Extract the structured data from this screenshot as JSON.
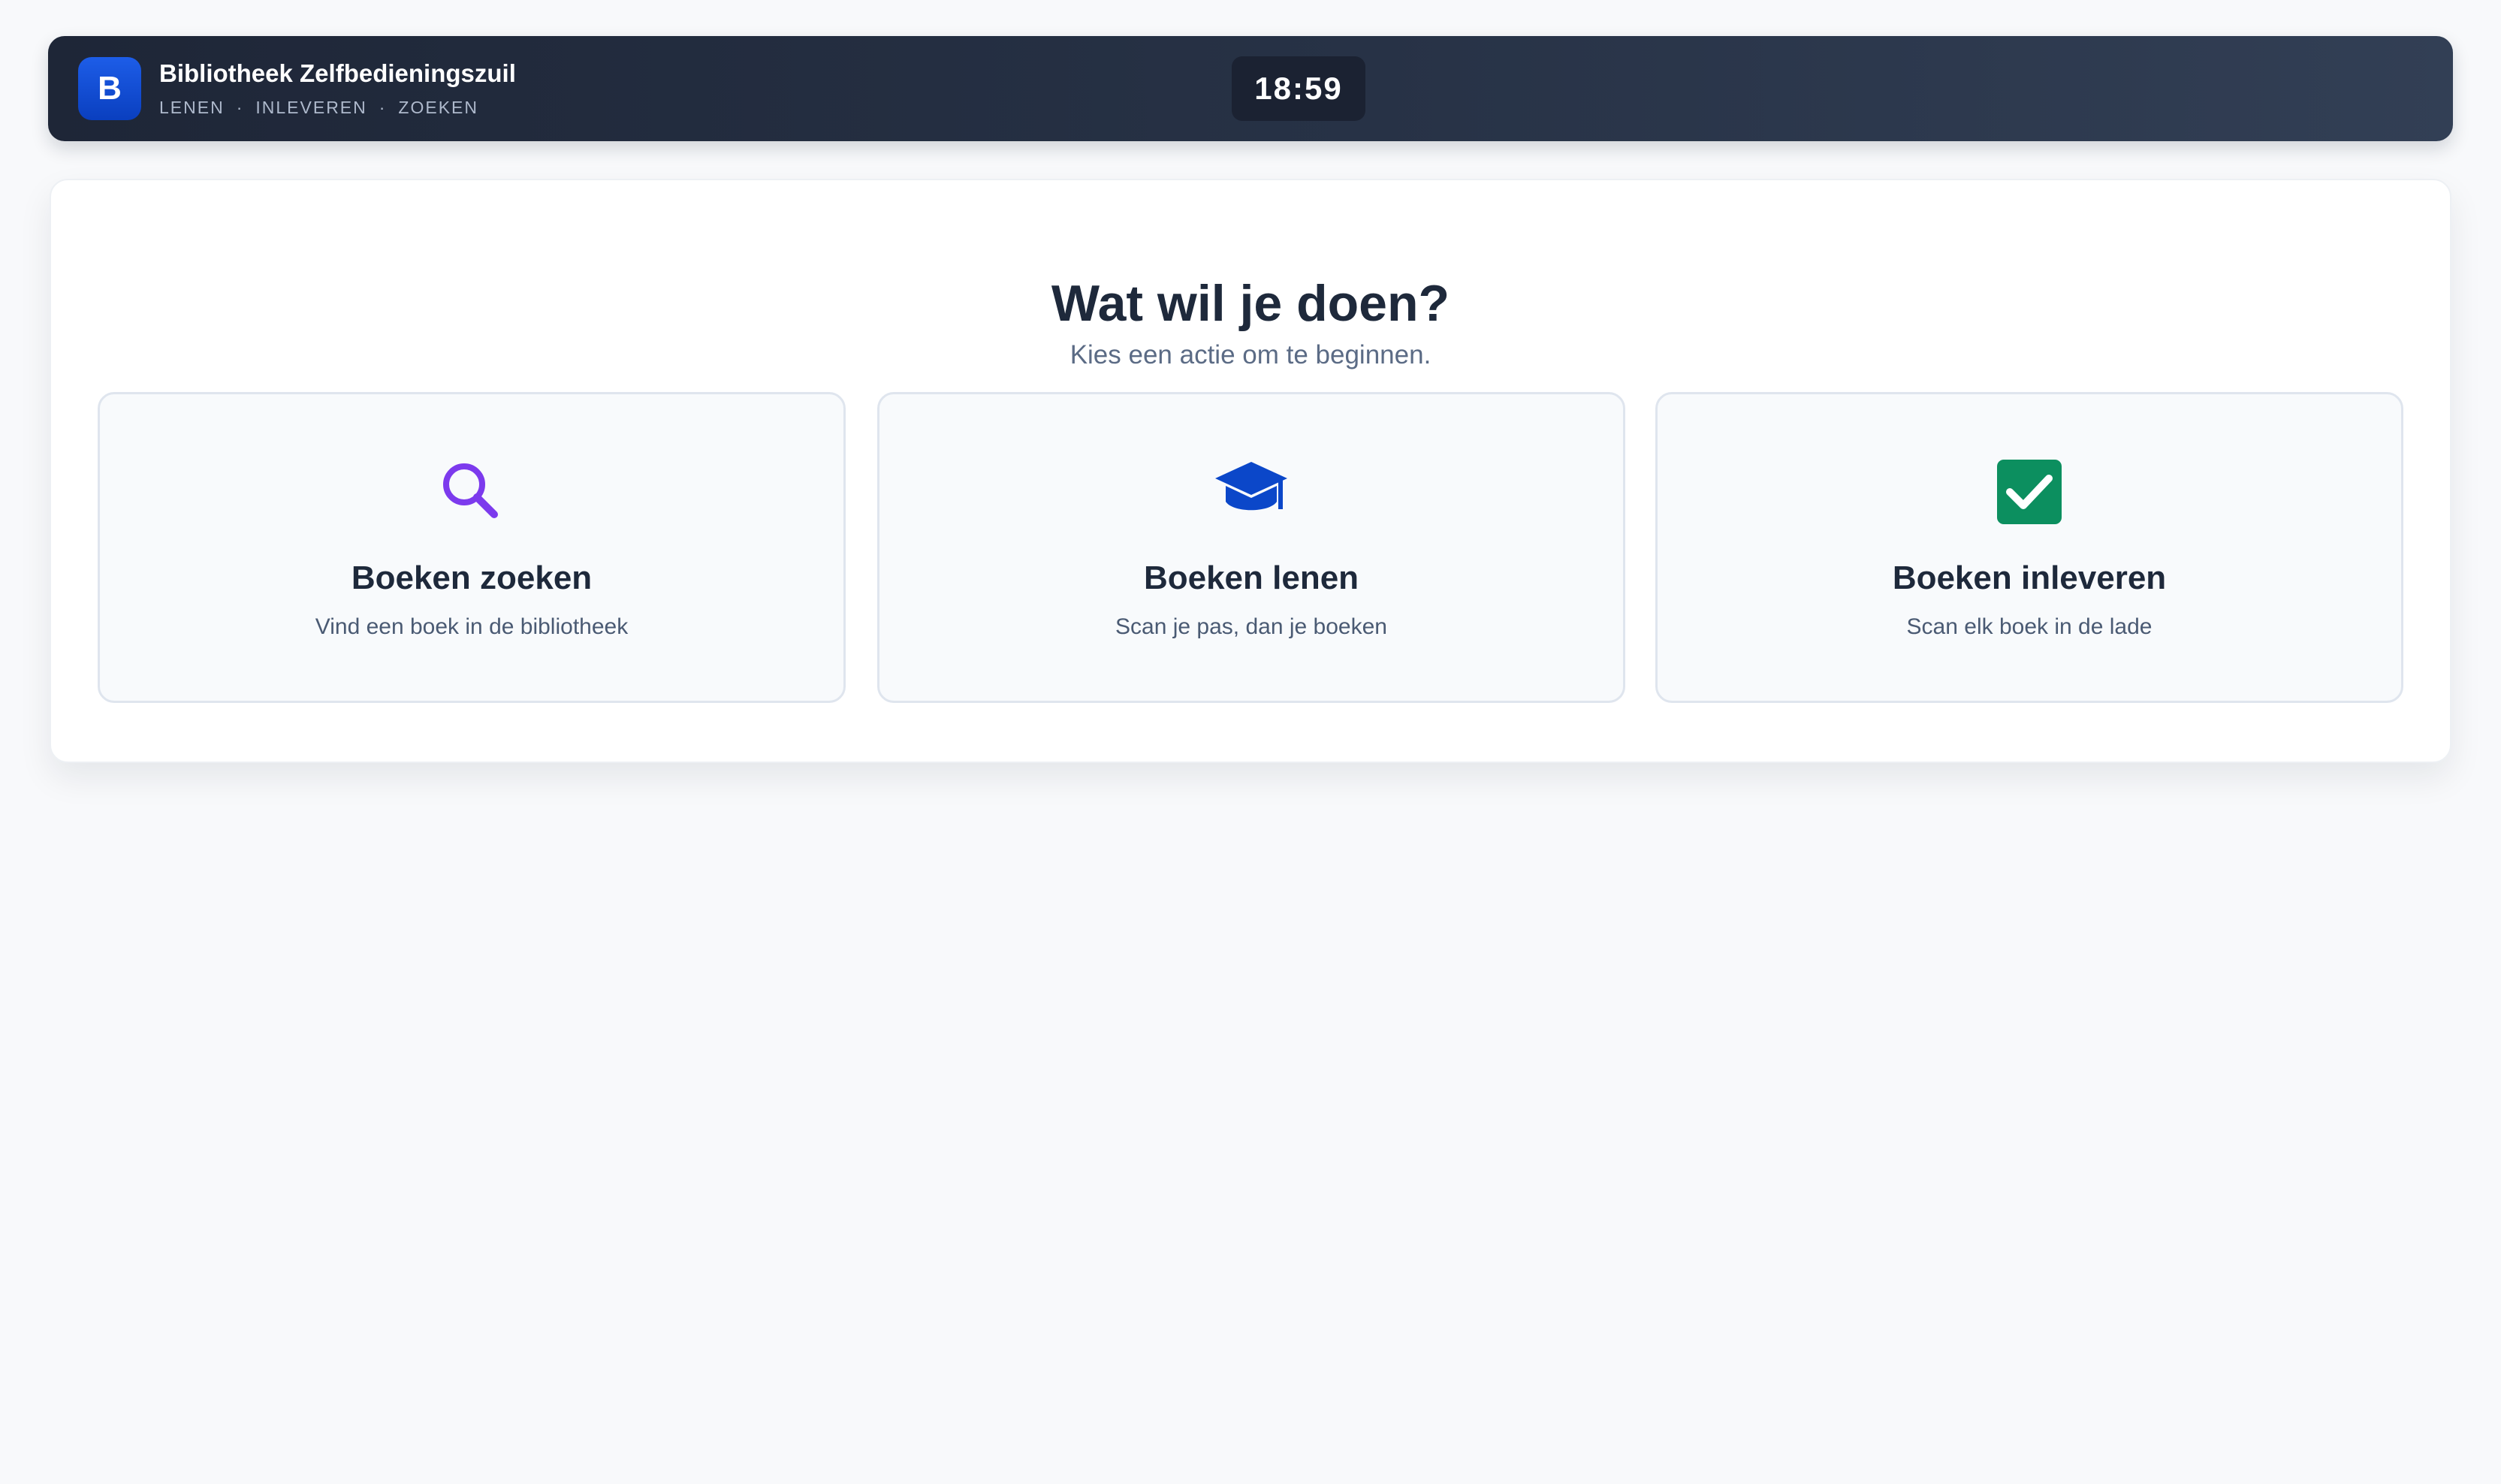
{
  "header": {
    "logo_letter": "B",
    "title": "Bibliotheek Zelfbedieningszuil",
    "nav": [
      "LENEN",
      "INLEVEREN",
      "ZOEKEN"
    ],
    "nav_separator": "·",
    "clock": "18:59"
  },
  "main": {
    "title": "Wat wil je doen?",
    "subtitle": "Kies een actie om te beginnen.",
    "actions": [
      {
        "icon": "search-icon",
        "icon_color": "#7c3aed",
        "title": "Boeken zoeken",
        "description": "Vind een boek in de bibliotheek"
      },
      {
        "icon": "graduation-cap-icon",
        "icon_color": "#0b47c9",
        "title": "Boeken lenen",
        "description": "Scan je pas, dan je boeken"
      },
      {
        "icon": "checkbox-checked-icon",
        "icon_color": "#0c8f5f",
        "title": "Boeken inleveren",
        "description": "Scan elk boek in de lade"
      }
    ]
  },
  "colors": {
    "header_background": "#273246",
    "logo_blue": "#0a3fbf",
    "page_background": "#f8f9fb",
    "card_background": "#ffffff",
    "text_dark": "#1e293b",
    "text_muted": "#5b6b85"
  }
}
